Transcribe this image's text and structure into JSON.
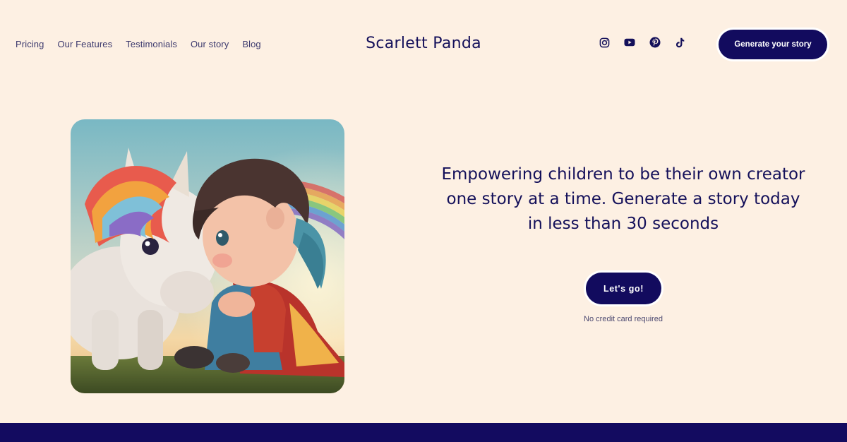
{
  "nav": {
    "items": [
      "Pricing",
      "Our Features",
      "Testimonials",
      "Our story",
      "Blog"
    ]
  },
  "brand": {
    "name": "Scarlett Panda"
  },
  "socials": [
    "instagram-icon",
    "youtube-icon",
    "pinterest-icon",
    "tiktok-icon"
  ],
  "header": {
    "cta_label": "Generate your story"
  },
  "hero": {
    "headline": "Empowering children to be their own creator one story at a time. Generate a story today in less than 30 seconds",
    "button_label": "Let's go!",
    "note": "No credit card required"
  },
  "colors": {
    "background": "#fdf0e3",
    "accent": "#120b5e",
    "text": "#14105a"
  }
}
